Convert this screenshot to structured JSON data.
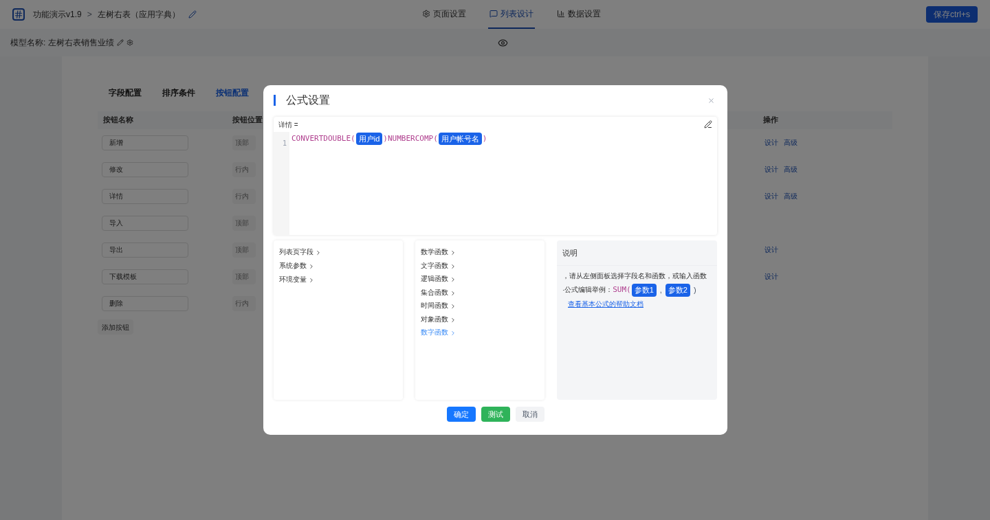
{
  "header": {
    "app": "功能演示v1.9",
    "separator": ">",
    "page": "左树右表（应用字典）",
    "tabs": [
      {
        "label": "页面设置",
        "kind": "gear",
        "selected": false
      },
      {
        "label": "列表设计",
        "kind": "list",
        "selected": true
      },
      {
        "label": "数据设置",
        "kind": "chart",
        "selected": false
      }
    ],
    "save_button": "保存ctrl+s"
  },
  "model": {
    "label": "模型名称:",
    "name": "左树右表销售业绩"
  },
  "config_tabs": [
    {
      "label": "字段配置",
      "selected": false
    },
    {
      "label": "排序条件",
      "selected": false
    },
    {
      "label": "按钮配置",
      "selected": true
    }
  ],
  "table": {
    "columns": [
      "按钮名称",
      "按钮位置",
      "操作"
    ],
    "rows": [
      {
        "name": "新增",
        "position": "顶部",
        "actions": [
          "设计",
          "高级"
        ]
      },
      {
        "name": "修改",
        "position": "行内",
        "actions": [
          "设计",
          "高级"
        ]
      },
      {
        "name": "详情",
        "position": "行内",
        "actions": [
          "设计",
          "高级"
        ]
      },
      {
        "name": "导入",
        "position": "顶部",
        "actions": []
      },
      {
        "name": "导出",
        "position": "顶部",
        "actions": [
          "设计"
        ]
      },
      {
        "name": "下载模板",
        "position": "顶部",
        "actions": [
          "设计"
        ]
      },
      {
        "name": "删除",
        "position": "行内",
        "actions": []
      }
    ],
    "add_button": "添加按钮"
  },
  "dialog": {
    "title": "公式设置",
    "editor": {
      "label": "详情 =",
      "line_number": "1",
      "tokens": [
        {
          "kind": "func",
          "text": "CONVERTDOUBLE("
        },
        {
          "kind": "field",
          "text": "用户id"
        },
        {
          "kind": "func",
          "text": ")NUMBERCOMP("
        },
        {
          "kind": "field",
          "text": "用户帐号名"
        },
        {
          "kind": "func",
          "text": ")"
        }
      ]
    },
    "field_groups": [
      {
        "label": "列表页字段",
        "selected": false
      },
      {
        "label": "系统参数",
        "selected": false
      },
      {
        "label": "环境变量",
        "selected": false
      }
    ],
    "functions": [
      {
        "label": "数学函数",
        "selected": false
      },
      {
        "label": "文字函数",
        "selected": false
      },
      {
        "label": "逻辑函数",
        "selected": false
      },
      {
        "label": "集合函数",
        "selected": false
      },
      {
        "label": "时间函数",
        "selected": false
      },
      {
        "label": "对象函数",
        "selected": false
      },
      {
        "label": "数字函数",
        "selected": true
      }
    ],
    "help": {
      "title": "说明",
      "hint": "，请从左侧面板选择字段名和函数，或输入函数",
      "example_label": "·公式编辑举例：",
      "example": [
        {
          "kind": "func",
          "text": "SUM("
        },
        {
          "kind": "field",
          "text": "参数1"
        },
        {
          "kind": "plain",
          "text": ","
        },
        {
          "kind": "field",
          "text": "参数2"
        },
        {
          "kind": "plain",
          "text": ")"
        }
      ],
      "link": "查看基本公式的帮助文档"
    },
    "buttons": [
      {
        "label": "确定",
        "kind": "primary"
      },
      {
        "label": "测试",
        "kind": "success"
      },
      {
        "label": "取消",
        "kind": "default"
      }
    ]
  }
}
